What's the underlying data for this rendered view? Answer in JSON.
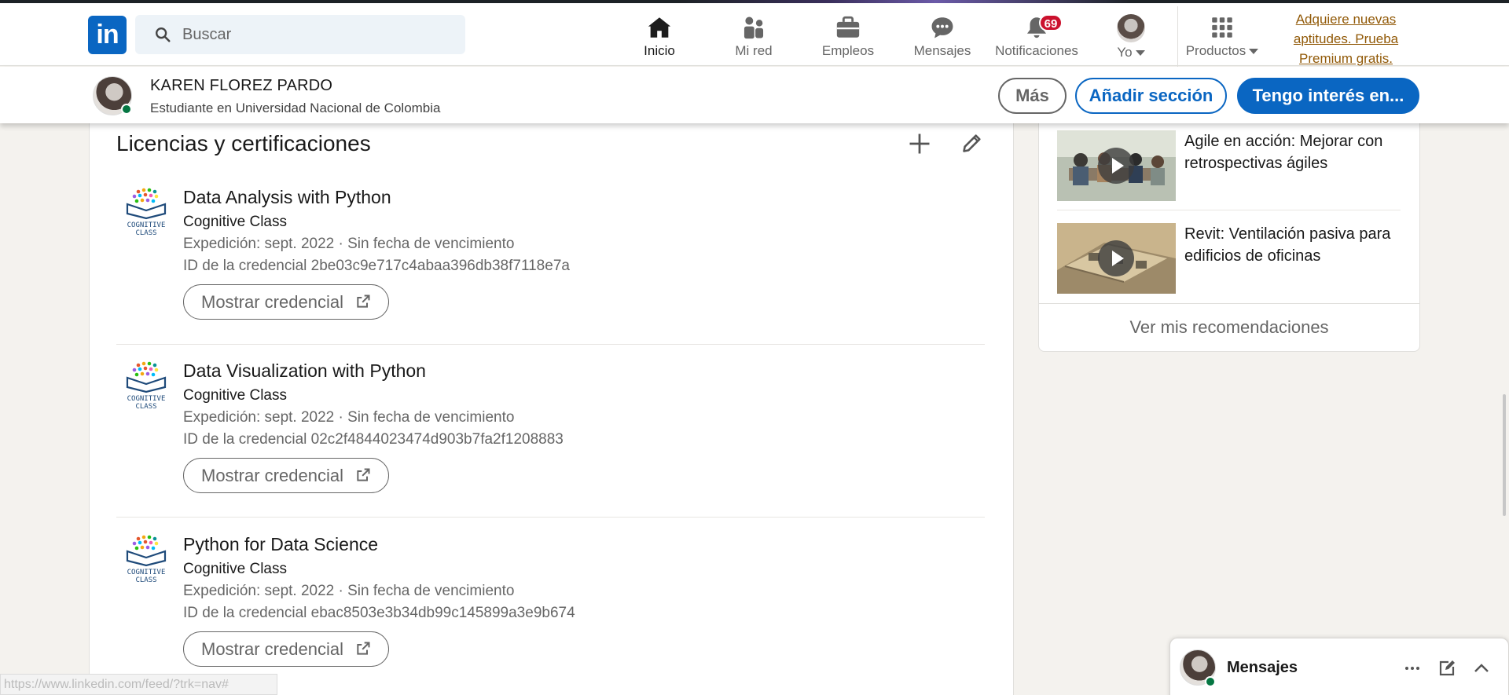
{
  "nav": {
    "search_placeholder": "Buscar",
    "items": [
      {
        "label": "Inicio",
        "icon": "home-icon",
        "active": true
      },
      {
        "label": "Mi red",
        "icon": "network-icon"
      },
      {
        "label": "Empleos",
        "icon": "briefcase-icon"
      },
      {
        "label": "Mensajes",
        "icon": "messaging-icon"
      },
      {
        "label": "Notificaciones",
        "icon": "bell-icon",
        "badge": "69"
      },
      {
        "label": "Yo",
        "icon": "avatar"
      },
      {
        "label": "Productos",
        "icon": "grid-icon"
      }
    ],
    "premium_line1": "Adquiere nuevas",
    "premium_line2": "aptitudes. Prueba",
    "premium_line3": "Premium gratis."
  },
  "profile": {
    "name": "KAREN FLOREZ PARDO",
    "headline": "Estudiante en Universidad Nacional de Colombia",
    "buttons": {
      "more": "Más",
      "add_section": "Añadir sección",
      "interested": "Tengo interés en..."
    }
  },
  "section": {
    "title": "Licencias y certificaciones",
    "certs": [
      {
        "name": "Data Analysis with Python",
        "issuer": "Cognitive Class",
        "date": "Expedición: sept. 2022 · Sin fecha de vencimiento",
        "credential_id": "ID de la credencial 2be03c9e717c4abaa396db38f7118e7a",
        "button": "Mostrar credencial"
      },
      {
        "name": "Data Visualization with Python",
        "issuer": "Cognitive Class",
        "date": "Expedición: sept. 2022 · Sin fecha de vencimiento",
        "credential_id": "ID de la credencial 02c2f4844023474d903b7fa2f1208883",
        "button": "Mostrar credencial"
      },
      {
        "name": "Python for Data Science",
        "issuer": "Cognitive Class",
        "date": "Expedición: sept. 2022 · Sin fecha de vencimiento",
        "credential_id": "ID de la credencial ebac8503e3b34db99c145899a3e9b674",
        "button": "Mostrar credencial"
      }
    ],
    "logo_text_1": "COGNITIVE",
    "logo_text_2": "CLASS"
  },
  "rail": {
    "courses": [
      {
        "title": "Agile en acción: Mejorar con retrospectivas ágiles"
      },
      {
        "title": "Revit: Ventilación pasiva para edificios de oficinas"
      }
    ],
    "see_more": "Ver mis recomendaciones"
  },
  "messaging": {
    "title": "Mensajes"
  },
  "status_url": "https://www.linkedin.com/feed/?trk=nav#",
  "colors": {
    "brand": "#0a66c2",
    "badge": "#cb112d",
    "premium": "#915907",
    "online": "#057642"
  }
}
